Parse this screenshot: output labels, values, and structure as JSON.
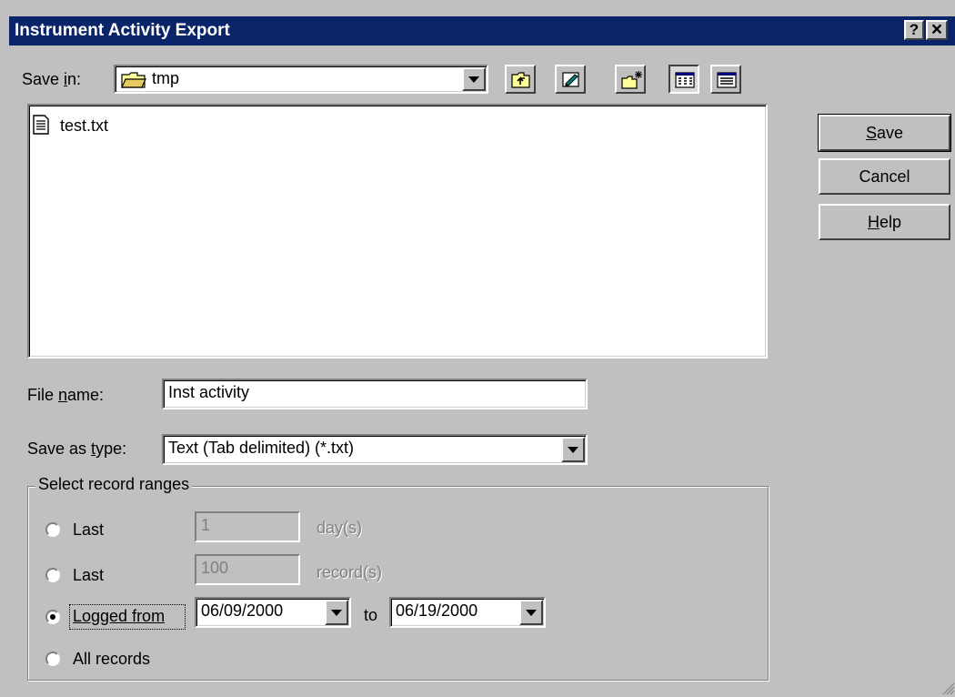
{
  "window": {
    "title": "Instrument Activity Export",
    "help_button": "?",
    "close_button": "×"
  },
  "save_in": {
    "label_pre": "Save ",
    "label_accel": "i",
    "label_post": "n:",
    "value": "tmp"
  },
  "toolbar": {
    "icons": [
      "up-one-level-icon",
      "desktop-icon",
      "new-folder-icon",
      "list-view-icon",
      "details-view-icon"
    ]
  },
  "files": [
    {
      "name": "test.txt",
      "icon": "text-file-icon"
    }
  ],
  "buttons": {
    "save": {
      "accel": "S",
      "rest": "ave"
    },
    "cancel": {
      "label": "Cancel"
    },
    "help": {
      "accel": "H",
      "rest": "elp"
    }
  },
  "file_name": {
    "label_pre": "File ",
    "label_accel": "n",
    "label_post": "ame:",
    "value": "Inst activity"
  },
  "save_as_type": {
    "label_pre": "Save as ",
    "label_accel": "t",
    "label_post": "ype:",
    "value": "Text (Tab delimited) (*.txt)"
  },
  "record_ranges": {
    "title": "Select record ranges",
    "last_days": {
      "label": "Last",
      "value": "1",
      "unit": "day(s)"
    },
    "last_records": {
      "label": "Last",
      "value": "100",
      "unit": "record(s)"
    },
    "logged_from": {
      "label": "Logged from",
      "from": "06/09/2000",
      "to_label": "to",
      "to": "06/19/2000"
    },
    "all_records": {
      "label": "All records"
    },
    "selected": "logged_from"
  },
  "colors": {
    "title_bar": "#0a246a",
    "face": "#c0c0c0"
  }
}
